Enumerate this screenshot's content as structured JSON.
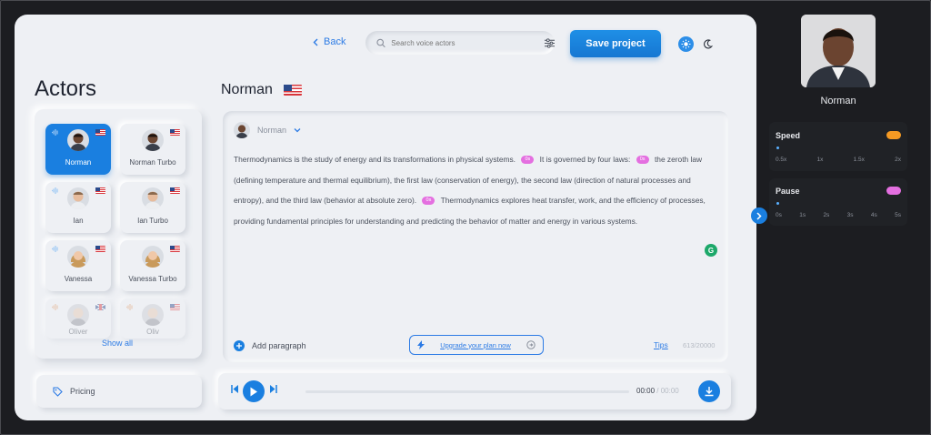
{
  "header": {
    "back_label": "Back",
    "search_placeholder": "Search voice actors",
    "save_label": "Save project"
  },
  "actors_title": "Actors",
  "current_actor": "Norman",
  "actors": [
    {
      "name": "Norman"
    },
    {
      "name": "Norman Turbo"
    },
    {
      "name": "Ian"
    },
    {
      "name": "Ian Turbo"
    },
    {
      "name": "Vanessa"
    },
    {
      "name": "Vanessa Turbo"
    },
    {
      "name": "Oliver"
    },
    {
      "name": "Oliv"
    }
  ],
  "show_all_label": "Show all",
  "pricing_label": "Pricing",
  "editor": {
    "voice_label": "Norman",
    "pause_tag": "0s",
    "segments": [
      "Thermodynamics is the study of energy and its transformations in physical systems.",
      "It is governed by four laws:",
      "the zeroth law (defining temperature and thermal equilibrium), the first law (conservation of energy), the second law (direction of natural processes and entropy), and the third law (behavior at absolute zero).",
      "Thermodynamics explores heat transfer, work, and the efficiency of processes, providing fundamental principles for understanding and predicting the behavior of matter and energy in various systems."
    ],
    "add_paragraph_label": "Add paragraph",
    "upgrade_label": "Upgrade your plan now",
    "tips_label": "Tips",
    "counter": "613/20000"
  },
  "player": {
    "current_time": "00:00",
    "total_time": "/ 00:00",
    "progress": 0
  },
  "side": {
    "actor_name": "Norman",
    "speed_title": "Speed",
    "speed_scale": [
      "0.5x",
      "1x",
      "1.5x",
      "2x"
    ],
    "pause_title": "Pause",
    "pause_scale": [
      "0s",
      "1s",
      "2s",
      "3s",
      "4s",
      "5s"
    ]
  },
  "colors": {
    "accent": "#1a7fe0",
    "speed_toggle": "#f59a23",
    "pause_toggle": "#e46fe0",
    "pause_tag": "#e46fe0"
  }
}
